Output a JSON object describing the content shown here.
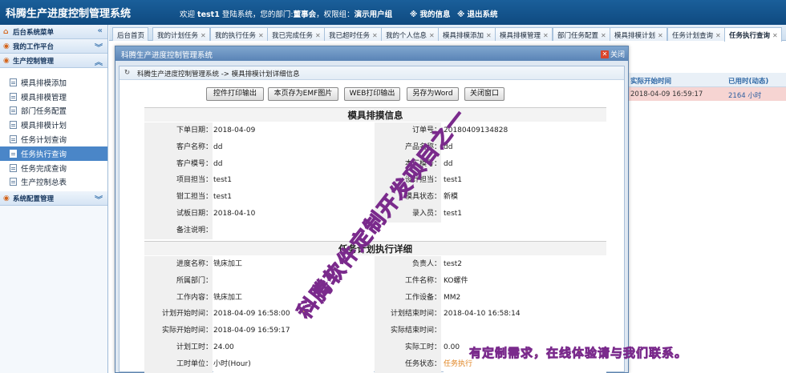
{
  "header": {
    "app_title": "科腾生产进度控制管理系统",
    "welcome_prefix": "欢迎",
    "username": "test1",
    "welcome_mid": "登陆系统，您的部门:",
    "department": "董事会",
    "role_prefix": "，权限组：",
    "role": "演示用户组",
    "my_info": "※ 我的信息",
    "logout": "※ 退出系统"
  },
  "sidebar": {
    "menu_title": "后台系统菜单",
    "workbench": "我的工作平台",
    "production": "生产控制管理",
    "items": [
      {
        "label": "模具排模添加"
      },
      {
        "label": "模具排模管理"
      },
      {
        "label": "部门任务配置"
      },
      {
        "label": "模具排模计划"
      },
      {
        "label": "任务计划查询"
      },
      {
        "label": "任务执行查询"
      },
      {
        "label": "任务完成查询"
      },
      {
        "label": "生产控制总表"
      }
    ],
    "config": "系统配置管理"
  },
  "tabs": [
    {
      "label": "后台首页"
    },
    {
      "label": "我的计划任务"
    },
    {
      "label": "我的执行任务"
    },
    {
      "label": "我已完成任务"
    },
    {
      "label": "我已超时任务"
    },
    {
      "label": "我的个人信息"
    },
    {
      "label": "模具排模添加"
    },
    {
      "label": "模具排模管理"
    },
    {
      "label": "部门任务配置"
    },
    {
      "label": "模具排模计划"
    },
    {
      "label": "任务计划查询"
    },
    {
      "label": "任务执行查询"
    }
  ],
  "background_table": {
    "col1": "实际开始时间",
    "col2": "已用时(动态)",
    "row_time": "2018-04-09 16:59:17",
    "row_used": "2164 小时"
  },
  "dialog": {
    "title": "科腾生产进度控制管理系统",
    "close": "关闭",
    "breadcrumb": "科腾生产进度控制管理系统 -> 模具排模计划详细信息",
    "buttons": {
      "print_ctrl": "控件打印输出",
      "save_emf": "本页存为EMF图片",
      "web_print": "WEB打印输出",
      "save_word": "另存为Word",
      "close_window": "关闭窗口"
    },
    "mold_title": "模具排摸信息",
    "mold_rows": [
      {
        "l1": "下单日期：",
        "v1": "2018-04-09",
        "l2": "订单号：",
        "v2": "2018040913482​8"
      },
      {
        "l1": "客户名称：",
        "v1": "dd",
        "l2": "产品名称：",
        "v2": "dd"
      },
      {
        "l1": "客户模号：",
        "v1": "dd",
        "l2": "本厂模号：",
        "v2": "dd"
      },
      {
        "l1": "项目担当：",
        "v1": "test1",
        "l2": "设计担当：",
        "v2": "test1"
      },
      {
        "l1": "钳工担当：",
        "v1": "test1",
        "l2": "模具状态：",
        "v2": "新模"
      },
      {
        "l1": "试板日期：",
        "v1": "2018-04-10",
        "l2": "录入员：",
        "v2": "test1"
      }
    ],
    "remark_label": "备注说明：",
    "remark_value": "",
    "task_title": "任务计划执行详细",
    "task_rows": [
      {
        "l1": "进度名称：",
        "v1": "铣床加工",
        "l2": "负责人：",
        "v2": "test2"
      },
      {
        "l1": "所属部门：",
        "v1": "",
        "l2": "工件名称：",
        "v2": "KO螺件"
      },
      {
        "l1": "工作内容：",
        "v1": "铣床加工",
        "l2": "工作设备：",
        "v2": "MM2"
      },
      {
        "l1": "计划开始时间：",
        "v1": "2018-04-09 16:58:00",
        "l2": "计划结束时间：",
        "v2": "2018-04-10 16:58:14"
      },
      {
        "l1": "实际开始时间：",
        "v1": "2018-04-09 16:59:17",
        "l2": "实际结束时间：",
        "v2": ""
      },
      {
        "l1": "计划工时：",
        "v1": "24.00",
        "l2": "实际工时：",
        "v2": "0.00"
      },
      {
        "l1": "工时单位：",
        "v1": "小时(Hour)",
        "l2": "任务状态：",
        "v2": "任务执行"
      }
    ]
  },
  "watermark": {
    "main": "科腾软件定制开发项目之一",
    "footer": "有定制需求，在线体验请与我们联系。"
  }
}
